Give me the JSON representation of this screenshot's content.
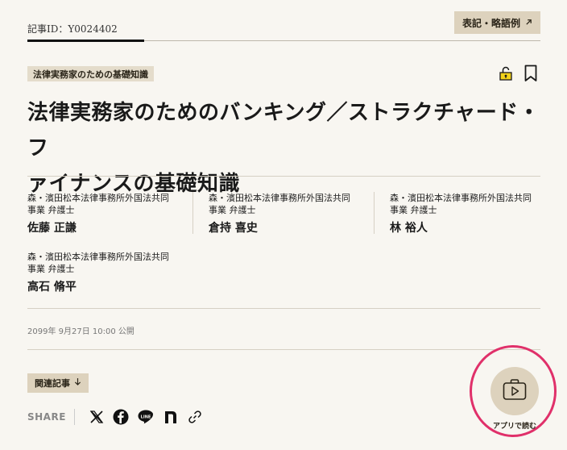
{
  "header": {
    "article_id": "記事ID：Y0024402",
    "notation_button": "表記・略語例"
  },
  "article": {
    "category": "法律実務家のための基礎知識",
    "title_line1": "法律実務家のためのバンキング／ストラクチャード・フ",
    "title_line2": "ァイナンスの基礎知識",
    "published": "2099年 9月27日 10:00 公開"
  },
  "authors": [
    {
      "affiliation_line1": "森・濱田松本法律事務所外国法共同",
      "affiliation_line2": "事業 弁護士",
      "name": "佐藤 正謙"
    },
    {
      "affiliation_line1": "森・濱田松本法律事務所外国法共同",
      "affiliation_line2": "事業 弁護士",
      "name": "倉持 喜史"
    },
    {
      "affiliation_line1": "森・濱田松本法律事務所外国法共同",
      "affiliation_line2": "事業 弁護士",
      "name": "林 裕人"
    },
    {
      "affiliation_line1": "森・濱田松本法律事務所外国法共同",
      "affiliation_line2": "事業 弁護士",
      "name": "高石 脩平"
    }
  ],
  "footer": {
    "related_button": "関連記事",
    "share_label": "SHARE",
    "share_icons": [
      "x-icon",
      "facebook-icon",
      "line-icon",
      "note-icon",
      "link-icon"
    ],
    "app_label": "アプリで読む"
  },
  "colors": {
    "accent_beige": "#ddd2bd",
    "highlight_ring": "#e0306a",
    "lock_yellow": "#f2d21b"
  }
}
